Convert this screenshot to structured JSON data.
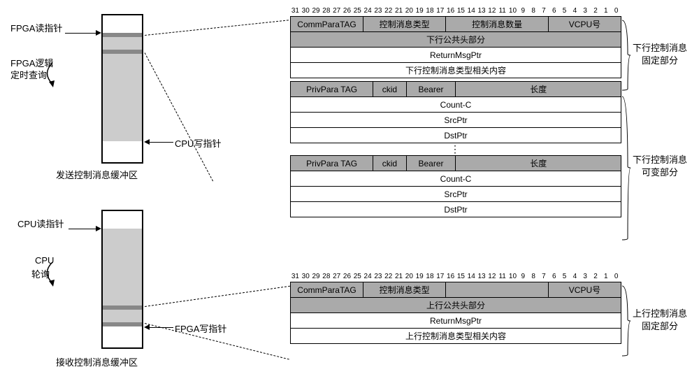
{
  "buffers": {
    "send": {
      "title": "发送控制消息缓冲区",
      "labels": {
        "readPtr": "FPGA读指针",
        "poll1": "FPGA逻辑",
        "poll2": "定时查询",
        "writePtr": "CPU写指针"
      }
    },
    "recv": {
      "title": "接收控制消息缓冲区",
      "labels": {
        "readPtr": "CPU读指针",
        "poll1": "CPU",
        "poll2": "轮询",
        "writePtr": "FPGA写指针"
      }
    }
  },
  "downlink": {
    "bits": [
      "31",
      "30",
      "29",
      "28",
      "27",
      "26",
      "25",
      "24",
      "23",
      "22",
      "21",
      "20",
      "19",
      "18",
      "17",
      "16",
      "15",
      "14",
      "13",
      "12",
      "11",
      "10",
      "9",
      "8",
      "7",
      "6",
      "5",
      "4",
      "3",
      "2",
      "1",
      "0"
    ],
    "header": {
      "commTag": "CommParaTAG",
      "msgType": "控制消息类型",
      "msgCount": "控制消息数量",
      "vcpu": "VCPU号"
    },
    "fixedRows": {
      "pubHeader": "下行公共头部分",
      "returnPtr": "ReturnMsgPtr",
      "typeContent": "下行控制消息类型相关内容"
    },
    "varHeader": {
      "privTag": "PrivPara TAG",
      "ckid": "ckid",
      "bearer": "Bearer",
      "length": "长度"
    },
    "varRows": {
      "countC": "Count-C",
      "srcPtr": "SrcPtr",
      "dstPtr": "DstPtr"
    },
    "sideLabels": {
      "fixed": "下行控制消息\n固定部分",
      "variable": "下行控制消息\n可变部分"
    }
  },
  "uplink": {
    "bits": [
      "31",
      "30",
      "29",
      "28",
      "27",
      "26",
      "25",
      "24",
      "23",
      "22",
      "21",
      "20",
      "19",
      "18",
      "17",
      "16",
      "15",
      "14",
      "13",
      "12",
      "11",
      "10",
      "9",
      "8",
      "7",
      "6",
      "5",
      "4",
      "3",
      "2",
      "1",
      "0"
    ],
    "header": {
      "commTag": "CommParaTAG",
      "msgType": "控制消息类型",
      "blank": "",
      "vcpu": "VCPU号"
    },
    "rows": {
      "pubHeader": "上行公共头部分",
      "returnPtr": "ReturnMsgPtr",
      "typeContent": "上行控制消息类型相关内容"
    },
    "sideLabel": "上行控制消息\n固定部分"
  },
  "chart_data": {
    "type": "table",
    "description": "Memory buffer layout diagram showing FPGA-CPU control message exchange format",
    "downlink_message_format": {
      "bit_width": 32,
      "fixed_part": [
        {
          "bits": "31-25",
          "field": "CommParaTAG"
        },
        {
          "bits": "24-17",
          "field": "控制消息类型"
        },
        {
          "bits": "16-7",
          "field": "控制消息数量"
        },
        {
          "bits": "6-0",
          "field": "VCPU号"
        },
        {
          "row": "下行公共头部分"
        },
        {
          "row": "ReturnMsgPtr"
        },
        {
          "row": "下行控制消息类型相关内容"
        }
      ],
      "variable_part_entry": [
        {
          "bits": "31-24",
          "field": "PrivPara TAG"
        },
        {
          "bits": "23-21",
          "field": "ckid"
        },
        {
          "bits": "20-16",
          "field": "Bearer"
        },
        {
          "bits": "15-0",
          "field": "长度"
        },
        {
          "row": "Count-C"
        },
        {
          "row": "SrcPtr"
        },
        {
          "row": "DstPtr"
        }
      ]
    },
    "uplink_message_format": {
      "bit_width": 32,
      "fixed_part": [
        {
          "bits": "31-25",
          "field": "CommParaTAG"
        },
        {
          "bits": "24-17",
          "field": "控制消息类型"
        },
        {
          "bits": "6-0",
          "field": "VCPU号"
        },
        {
          "row": "上行公共头部分"
        },
        {
          "row": "ReturnMsgPtr"
        },
        {
          "row": "上行控制消息类型相关内容"
        }
      ]
    }
  }
}
